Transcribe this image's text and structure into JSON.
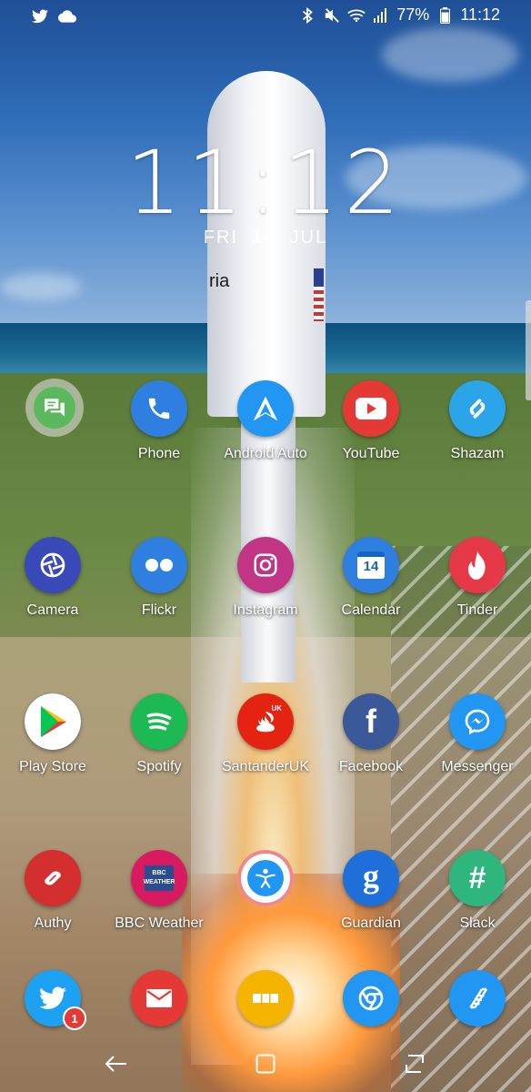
{
  "status_bar": {
    "battery": "77%",
    "time": "11:12",
    "left_icons": [
      "twitter-icon",
      "cloud-icon"
    ],
    "right_icons": [
      "bluetooth-icon",
      "mute-icon",
      "wifi-icon",
      "signal-icon",
      "battery-icon"
    ]
  },
  "lockclock": {
    "time": "11:12",
    "day": "FRI",
    "date": "14",
    "month": "JUL"
  },
  "wallpaper": {
    "rocket_text": "ria"
  },
  "apps": [
    {
      "label": "Phone",
      "color": "#2f7fe0",
      "icon": "phone-icon"
    },
    {
      "label": "Android Auto",
      "color": "#2196f3",
      "icon": "android-auto-icon"
    },
    {
      "label": "YouTube",
      "color": "#e53935",
      "icon": "youtube-icon"
    },
    {
      "label": "Shazam",
      "color": "#2ba5e8",
      "icon": "shazam-icon"
    },
    {
      "label": "Camera",
      "color": "#3a49b8",
      "icon": "camera-aperture-icon"
    },
    {
      "label": "Flickr",
      "color": "#2f7fe0",
      "icon": "flickr-icon"
    },
    {
      "label": "Instagram",
      "color": "#c13584",
      "icon": "instagram-icon"
    },
    {
      "label": "Calendar",
      "color": "#2f7fe0",
      "icon": "calendar-icon",
      "icon_text": "14"
    },
    {
      "label": "Tinder",
      "color": "#e53948",
      "icon": "flame-icon"
    },
    {
      "label": "Play Store",
      "color": "#2196f3",
      "icon": "play-store-icon"
    },
    {
      "label": "Spotify",
      "color": "#1db954",
      "icon": "spotify-icon"
    },
    {
      "label": "SantanderUK",
      "color": "#e42312",
      "icon": "santander-icon",
      "icon_text": "UK"
    },
    {
      "label": "Facebook",
      "color": "#3b5998",
      "icon": "facebook-icon",
      "icon_text": "f"
    },
    {
      "label": "Messenger",
      "color": "#2196f3",
      "icon": "messenger-icon"
    },
    {
      "label": "Authy",
      "color": "#d32f2f",
      "icon": "authy-icon"
    },
    {
      "label": "BBC Weather",
      "color": "#d81b60",
      "icon": "bbc-weather-icon",
      "icon_text": "BBC WEATHER"
    },
    {
      "label": "",
      "color": "#e53935",
      "icon": "fitness-figure-icon"
    },
    {
      "label": "Guardian",
      "color": "#1e6fd9",
      "icon": "guardian-icon",
      "icon_text": "g"
    },
    {
      "label": "Slack",
      "color": "#2eb67d",
      "icon": "slack-icon",
      "icon_text": "#"
    }
  ],
  "dock": [
    {
      "name": "twitter",
      "color": "#1da1f2",
      "icon": "twitter-icon",
      "badge": "1"
    },
    {
      "name": "email",
      "color": "#e53935",
      "icon": "mail-icon"
    },
    {
      "name": "app-drawer",
      "color": "#f4b400",
      "icon": "app-drawer-icon"
    },
    {
      "name": "chrome",
      "color": "#2196f3",
      "icon": "chrome-icon"
    },
    {
      "name": "pinned-app",
      "color": "#2196f3",
      "icon": "ribbon-icon"
    }
  ],
  "nav_bar": {
    "buttons": [
      "back-icon",
      "home-icon",
      "recents-icon"
    ]
  }
}
